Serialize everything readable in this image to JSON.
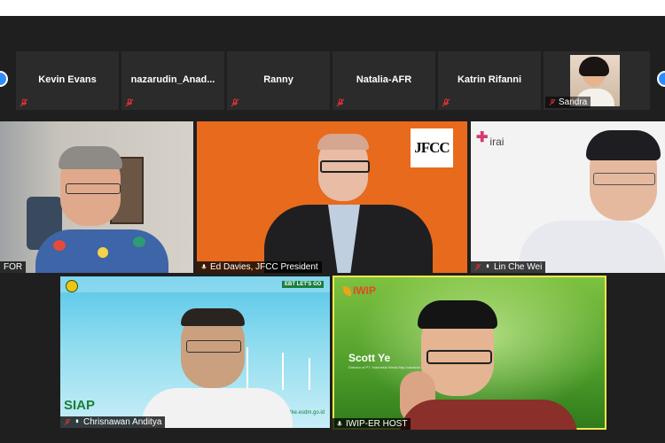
{
  "thumbnails": [
    {
      "name": "Kevin Evans"
    },
    {
      "name": "nazarudin_Anad..."
    },
    {
      "name": "Ranny"
    },
    {
      "name": "Natalia-AFR"
    },
    {
      "name": "Katrin Rifanni"
    },
    {
      "name": "Sandra"
    }
  ],
  "tiles": {
    "tile1": {
      "name": "FOR"
    },
    "tile2": {
      "name": "Ed Davies, JFCC President",
      "logo": "JFCC"
    },
    "tile3": {
      "name": "Lin Che Wei",
      "logo": "irai"
    },
    "tile4": {
      "name": "Chrisnawan Anditya",
      "banner": "SIAP",
      "eth_label": "EBT LET'S GO",
      "url": "ebtke.esdm.go.id"
    },
    "tile5": {
      "name": "IWIP-ER HOST",
      "logo": "IWIP",
      "speaker": "Scott Ye",
      "speaker_title": "Director of PT. Indonesia Weda Bay Industrial Park"
    }
  },
  "colors": {
    "background": "#1f1f1f",
    "thumb_bg": "#2b2b2b",
    "active_speaker_border": "#f4e84a",
    "nav_button": "#2d8cff",
    "muted_mic": "#e03131"
  }
}
